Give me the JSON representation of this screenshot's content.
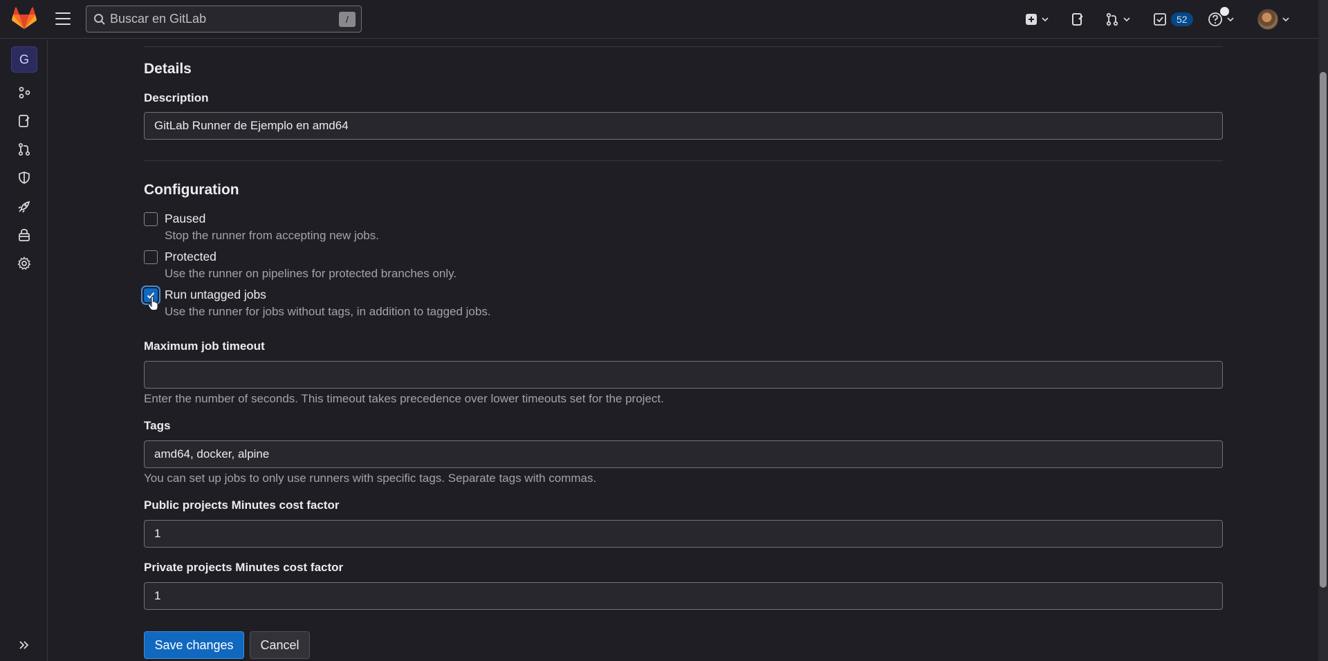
{
  "app": {
    "brand_color": "#fc6d26",
    "accent": "#1068bf"
  },
  "topbar": {
    "search_placeholder": "Buscar en GitLab",
    "search_shortcut": "/",
    "todo_count": "52",
    "icons": [
      "plus-square-icon",
      "issues-icon",
      "merge-request-icon",
      "todo-icon",
      "help-icon"
    ]
  },
  "sidebar": {
    "project_initial": "G",
    "items": [
      "manage-icon",
      "plan-icon",
      "code-icon",
      "secure-icon",
      "deploy-icon",
      "operate-icon",
      "settings-icon"
    ]
  },
  "details": {
    "heading": "Details",
    "description_label": "Description",
    "description_value": "GitLab Runner de Ejemplo en amd64"
  },
  "configuration": {
    "heading": "Configuration",
    "options": [
      {
        "label": "Paused",
        "help": "Stop the runner from accepting new jobs.",
        "checked": false
      },
      {
        "label": "Protected",
        "help": "Use the runner on pipelines for protected branches only.",
        "checked": false
      },
      {
        "label": "Run untagged jobs",
        "help": "Use the runner for jobs without tags, in addition to tagged jobs.",
        "checked": true
      }
    ],
    "timeout_label": "Maximum job timeout",
    "timeout_value": "",
    "timeout_help": "Enter the number of seconds. This timeout takes precedence over lower timeouts set for the project.",
    "tags_label": "Tags",
    "tags_value": "amd64, docker, alpine",
    "tags_help": "You can set up jobs to only use runners with specific tags. Separate tags with commas.",
    "public_cost_label": "Public projects Minutes cost factor",
    "public_cost_value": "1",
    "private_cost_label": "Private projects Minutes cost factor",
    "private_cost_value": "1"
  },
  "actions": {
    "save_label": "Save changes",
    "cancel_label": "Cancel"
  }
}
